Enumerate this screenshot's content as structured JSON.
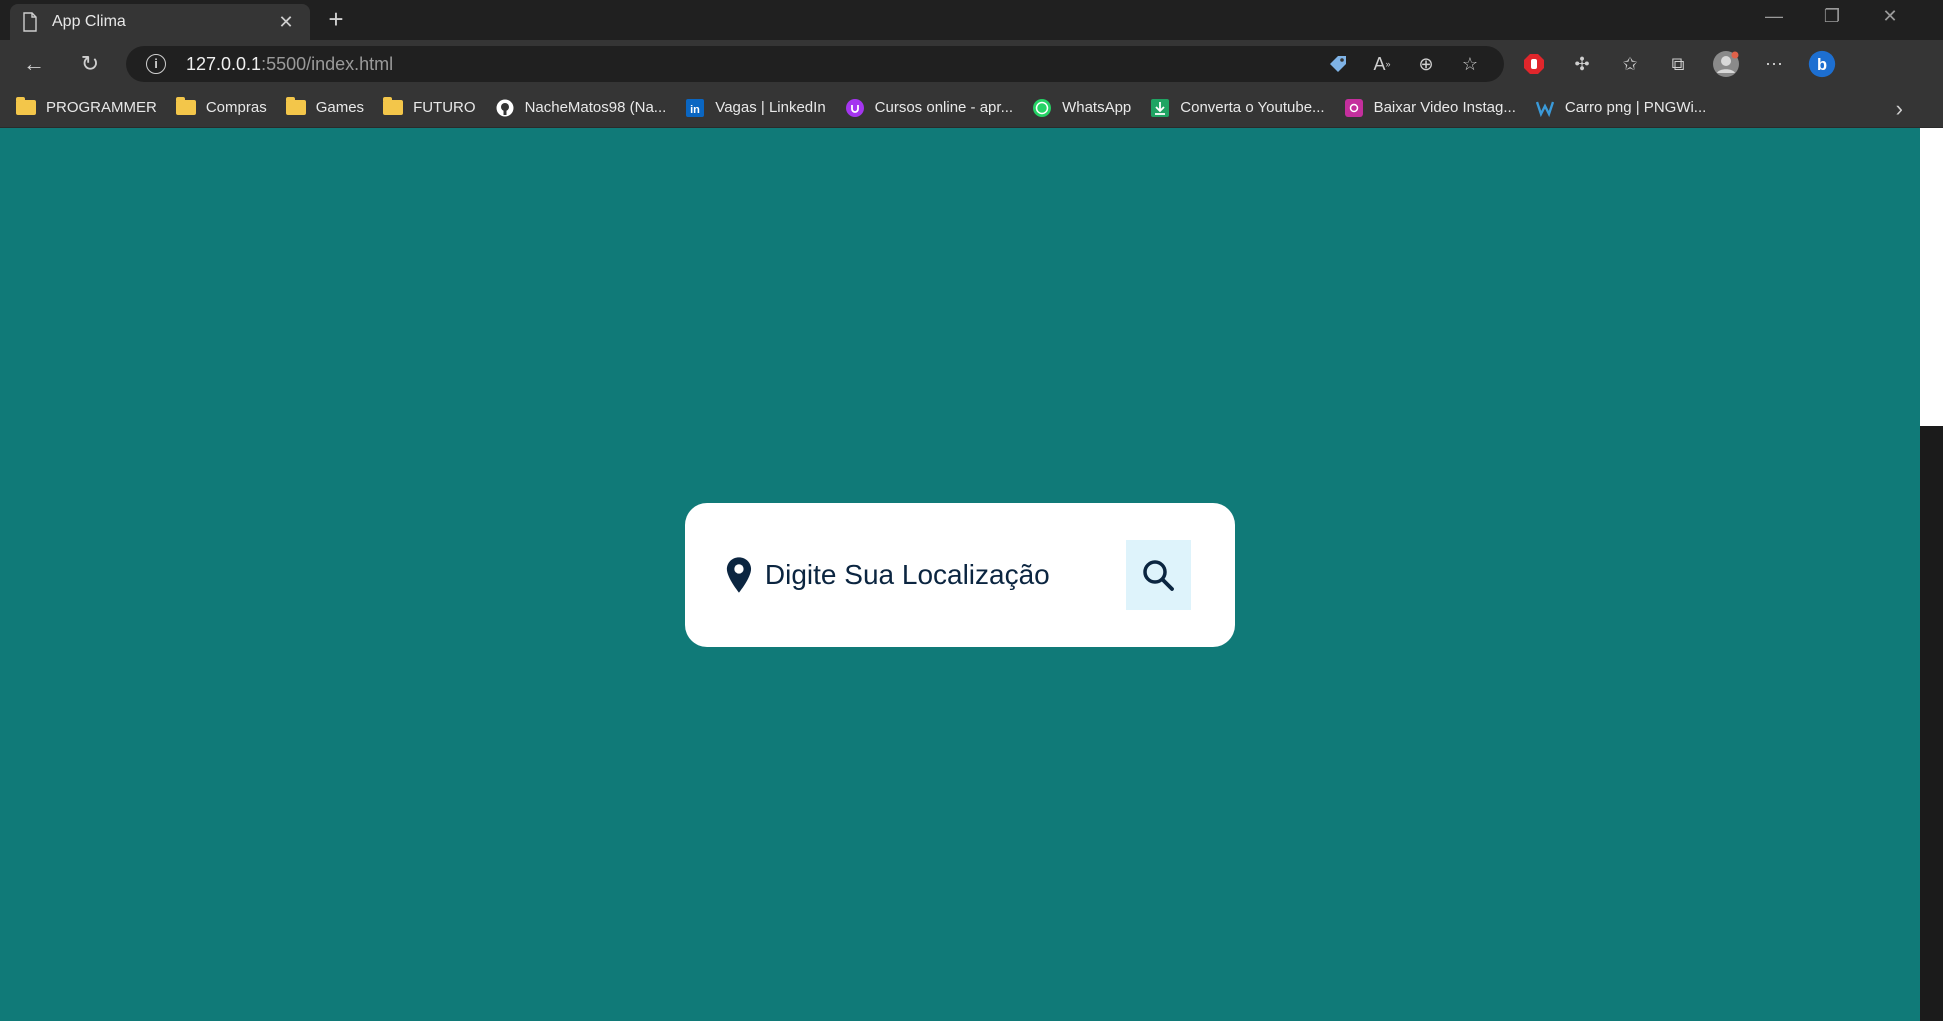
{
  "browser": {
    "tab_title": "App Clima",
    "url_host": "127.0.0.1",
    "url_path": ":5500/index.html"
  },
  "bookmarks": [
    {
      "label": "PROGRAMMER",
      "icon": "folder-icon"
    },
    {
      "label": "Compras",
      "icon": "folder-icon"
    },
    {
      "label": "Games",
      "icon": "folder-icon"
    },
    {
      "label": "FUTURO",
      "icon": "folder-icon"
    },
    {
      "label": "NacheMatos98 (Na...",
      "icon": "github-icon"
    },
    {
      "label": "Vagas | LinkedIn",
      "icon": "linkedin-icon"
    },
    {
      "label": "Cursos online - apr...",
      "icon": "udemy-icon"
    },
    {
      "label": "WhatsApp",
      "icon": "whatsapp-icon"
    },
    {
      "label": "Converta o Youtube...",
      "icon": "download-icon"
    },
    {
      "label": "Baixar Video Instag...",
      "icon": "instagram-icon"
    },
    {
      "label": "Carro png | PNGWi...",
      "icon": "pngwing-icon"
    }
  ],
  "app": {
    "search_placeholder": "Digite Sua Localização"
  },
  "colors": {
    "page_background": "#107a78",
    "card_background": "#ffffff",
    "search_button_bg": "#def3fb",
    "text_dark": "#0b2540"
  }
}
